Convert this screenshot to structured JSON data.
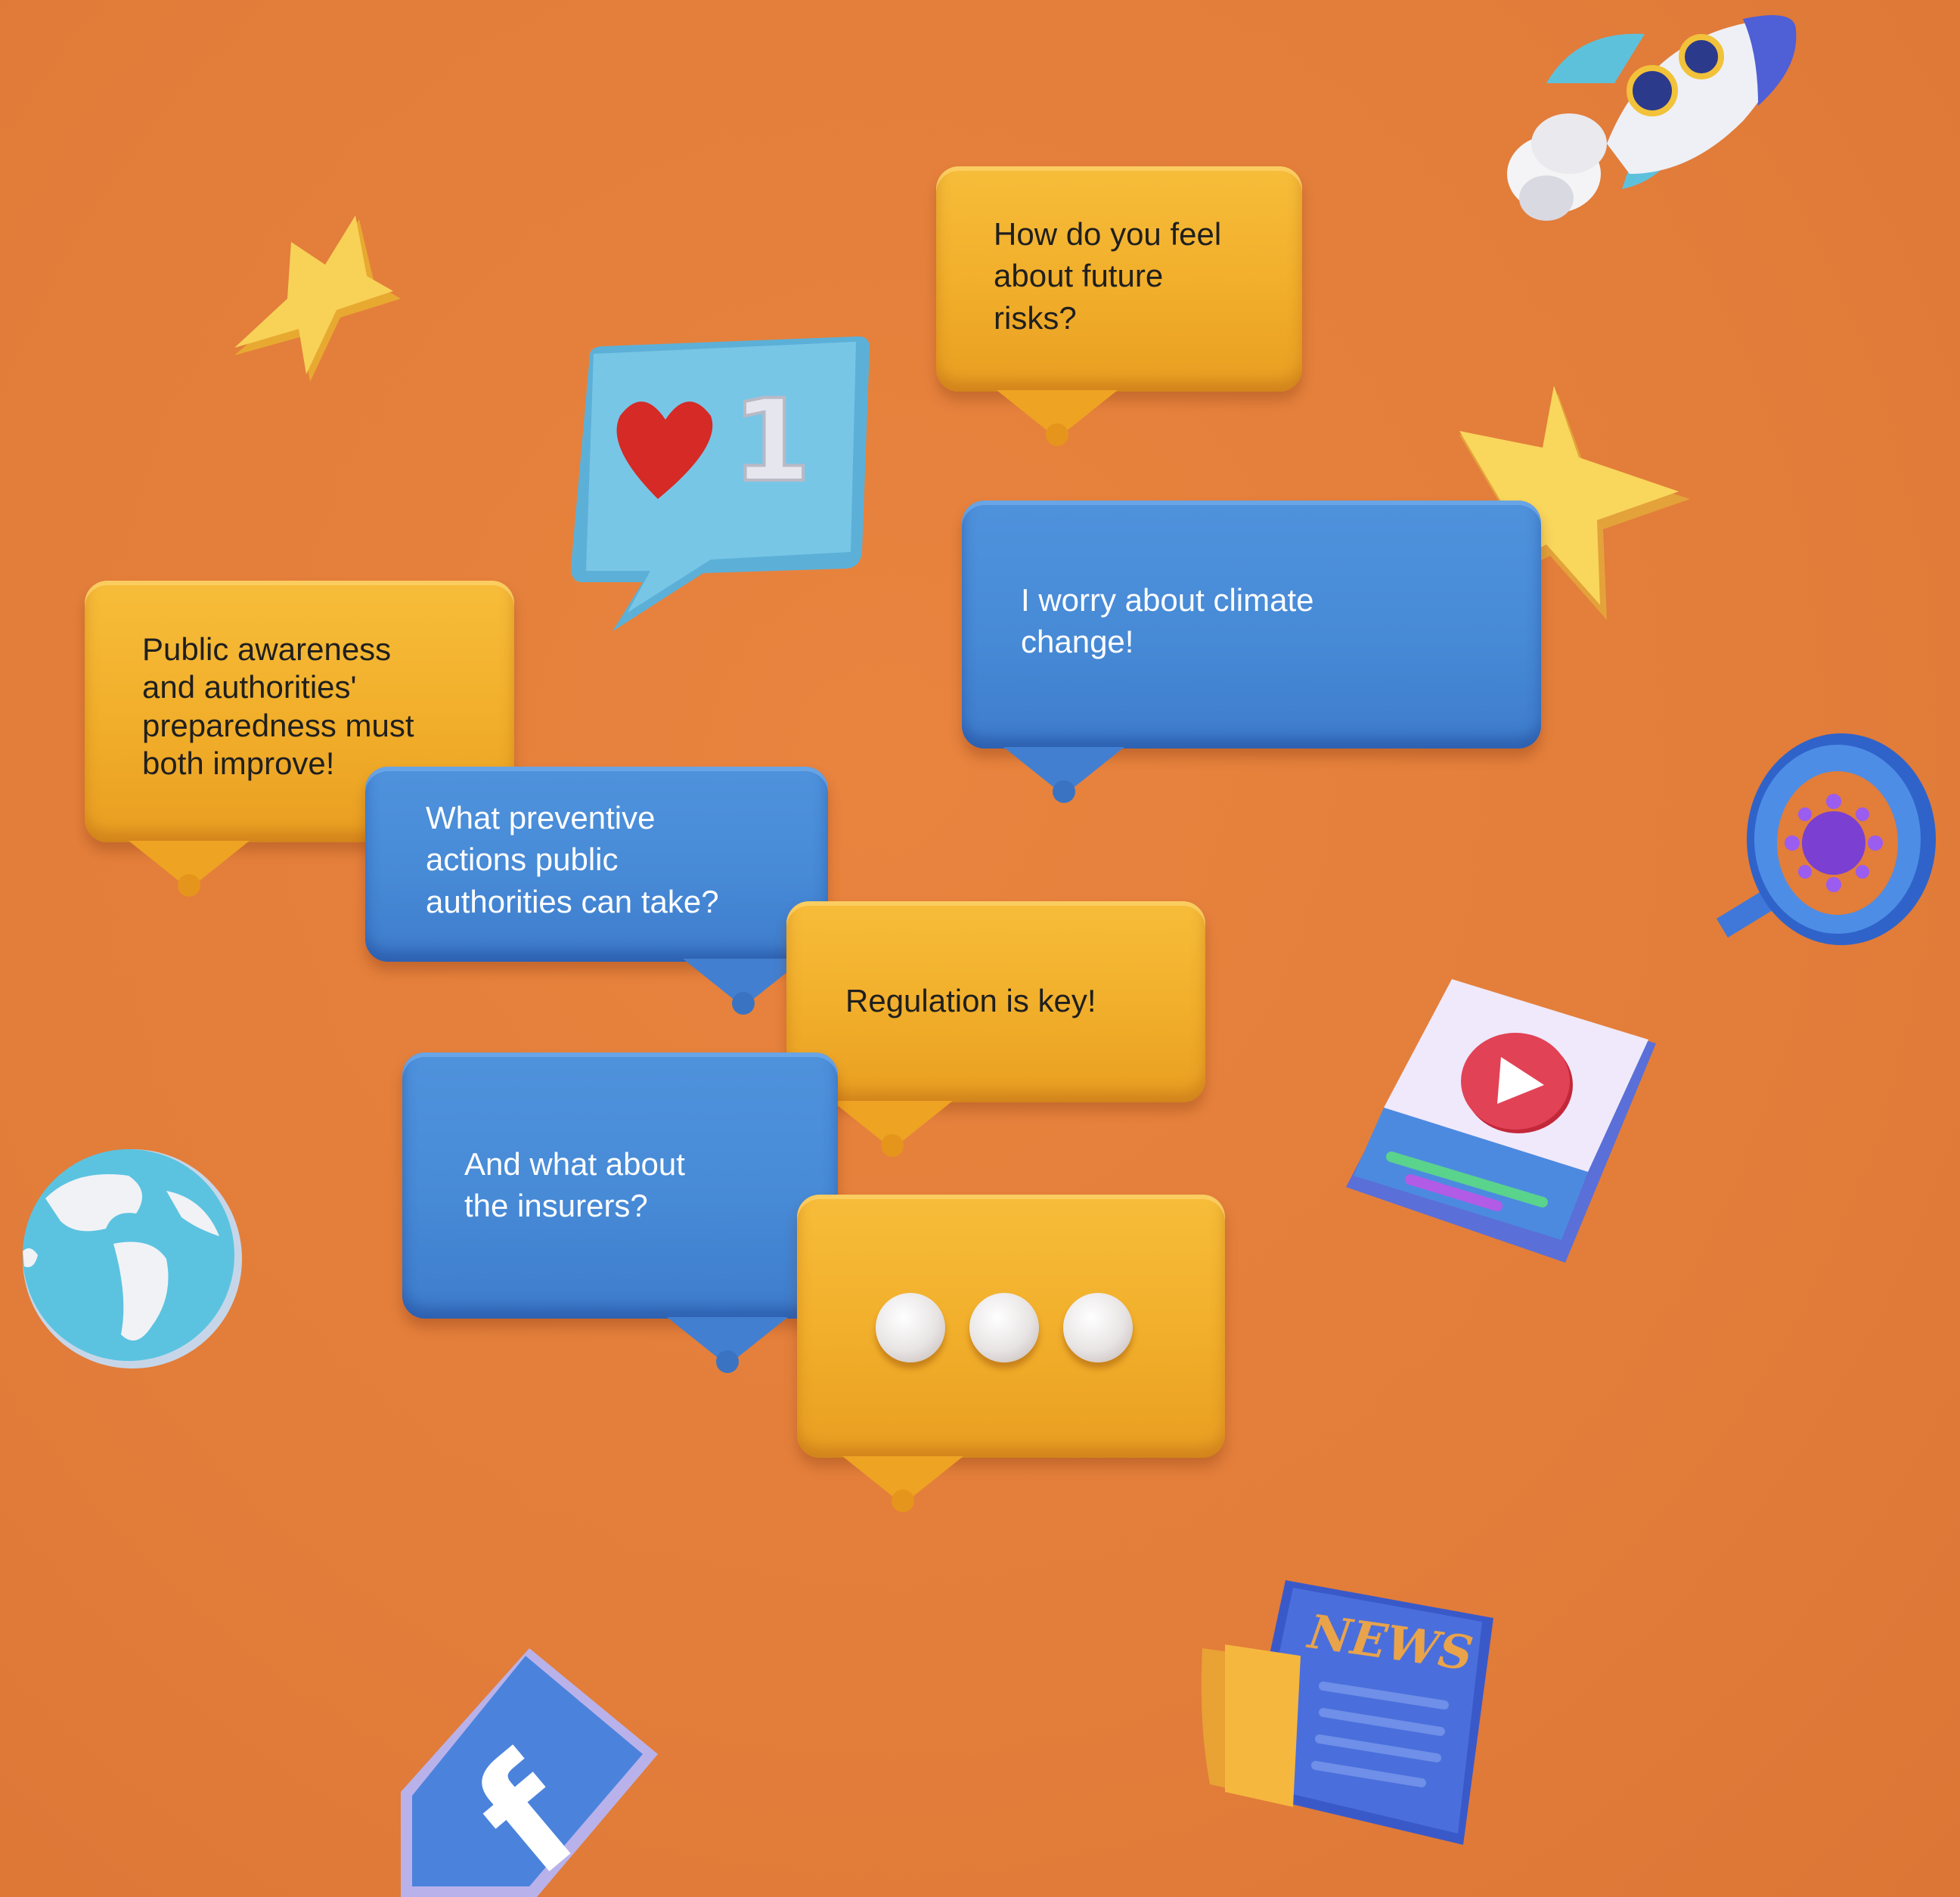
{
  "background_color": "#e2803b",
  "bubbles": {
    "future_risks": "How do you feel\nabout future\nrisks?",
    "climate": "I worry about climate\nchange!",
    "public_awareness": "Public awareness\nand authorities'\npreparedness must\nboth improve!",
    "preventive_actions": "What preventive\nactions public\nauthorities can take?",
    "regulation": "Regulation is key!",
    "insurers": "And what about\nthe insurers?"
  },
  "like_badge": {
    "count": "1"
  },
  "news_label": "NEWS",
  "facebook_glyph": "f",
  "icons": [
    "star-icon",
    "rocket-icon",
    "heart-icon",
    "magnifier-virus-icon",
    "video-play-icon",
    "globe-icon",
    "facebook-icon",
    "newspaper-icon",
    "ellipsis-icon"
  ]
}
